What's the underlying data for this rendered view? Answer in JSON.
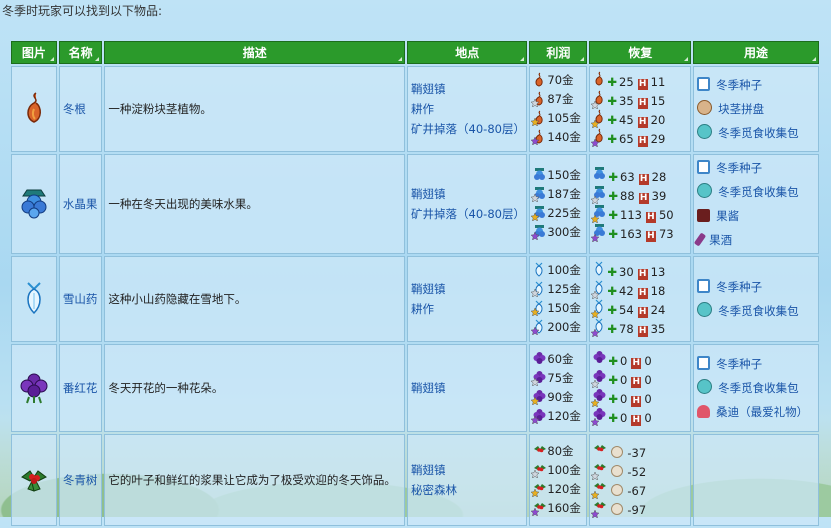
{
  "intro": "冬季时玩家可以找到以下物品:",
  "headers": {
    "image": "图片",
    "name": "名称",
    "desc": "描述",
    "location": "地点",
    "profit": "利润",
    "recovery": "恢复",
    "use": "用途"
  },
  "rows": [
    {
      "name": "冬根",
      "icon": "winter-root-icon",
      "desc": "一种淀粉块茎植物。",
      "locations": [
        "鞘翅镇",
        "耕作",
        "矿井掉落（40-80层）"
      ],
      "prices": [
        "70金",
        "87金",
        "105金",
        "140金"
      ],
      "recovery": [
        {
          "energy": "25",
          "health": "11"
        },
        {
          "energy": "35",
          "health": "15"
        },
        {
          "energy": "45",
          "health": "20"
        },
        {
          "energy": "65",
          "health": "29"
        }
      ],
      "uses": [
        {
          "icon": "seed-pack-icon",
          "label": "冬季种子"
        },
        {
          "icon": "dish-icon",
          "label": "块茎拼盘"
        },
        {
          "icon": "bundle-icon",
          "label": "冬季觅食收集包"
        }
      ]
    },
    {
      "name": "水晶果",
      "icon": "crystal-fruit-icon",
      "desc": "一种在冬天出现的美味水果。",
      "locations": [
        "鞘翅镇",
        "矿井掉落（40-80层）"
      ],
      "prices": [
        "150金",
        "187金",
        "225金",
        "300金"
      ],
      "recovery": [
        {
          "energy": "63",
          "health": "28"
        },
        {
          "energy": "88",
          "health": "39"
        },
        {
          "energy": "113",
          "health": "50"
        },
        {
          "energy": "163",
          "health": "73"
        }
      ],
      "uses": [
        {
          "icon": "seed-pack-icon",
          "label": "冬季种子"
        },
        {
          "icon": "bundle-icon",
          "label": "冬季觅食收集包"
        },
        {
          "icon": "jelly-icon",
          "label": "果酱"
        },
        {
          "icon": "wine-icon",
          "label": "果酒"
        }
      ]
    },
    {
      "name": "雪山药",
      "icon": "snow-yam-icon",
      "desc": "这种小山药隐藏在雪地下。",
      "locations": [
        "鞘翅镇",
        "耕作"
      ],
      "prices": [
        "100金",
        "125金",
        "150金",
        "200金"
      ],
      "recovery": [
        {
          "energy": "30",
          "health": "13"
        },
        {
          "energy": "42",
          "health": "18"
        },
        {
          "energy": "54",
          "health": "24"
        },
        {
          "energy": "78",
          "health": "35"
        }
      ],
      "uses": [
        {
          "icon": "seed-pack-icon",
          "label": "冬季种子"
        },
        {
          "icon": "bundle-icon",
          "label": "冬季觅食收集包"
        }
      ]
    },
    {
      "name": "番红花",
      "icon": "crocus-icon",
      "desc": "冬天开花的一种花朵。",
      "locations": [
        "鞘翅镇"
      ],
      "prices": [
        "60金",
        "75金",
        "90金",
        "120金"
      ],
      "recovery": [
        {
          "energy": "0",
          "health": "0"
        },
        {
          "energy": "0",
          "health": "0"
        },
        {
          "energy": "0",
          "health": "0"
        },
        {
          "energy": "0",
          "health": "0"
        }
      ],
      "uses": [
        {
          "icon": "seed-pack-icon",
          "label": "冬季种子"
        },
        {
          "icon": "bundle-icon",
          "label": "冬季觅食收集包"
        },
        {
          "icon": "npc-portrait-icon",
          "label": "桑迪（最爱礼物）"
        }
      ]
    },
    {
      "name": "冬青树",
      "icon": "holly-icon",
      "desc": "它的叶子和鲜红的浆果让它成为了极受欢迎的冬天饰品。",
      "locations": [
        "鞘翅镇",
        "秘密森林"
      ],
      "prices": [
        "80金",
        "100金",
        "120金",
        "160金"
      ],
      "recovery_poison": [
        "-37",
        "-52",
        "-67",
        "-97"
      ],
      "uses": []
    }
  ],
  "colors": {
    "header": "#2b9a2b",
    "link": "#1a55a8",
    "gold": "#e8b020",
    "silver": "#cfd6de",
    "iridium": "#8e4ad0"
  }
}
